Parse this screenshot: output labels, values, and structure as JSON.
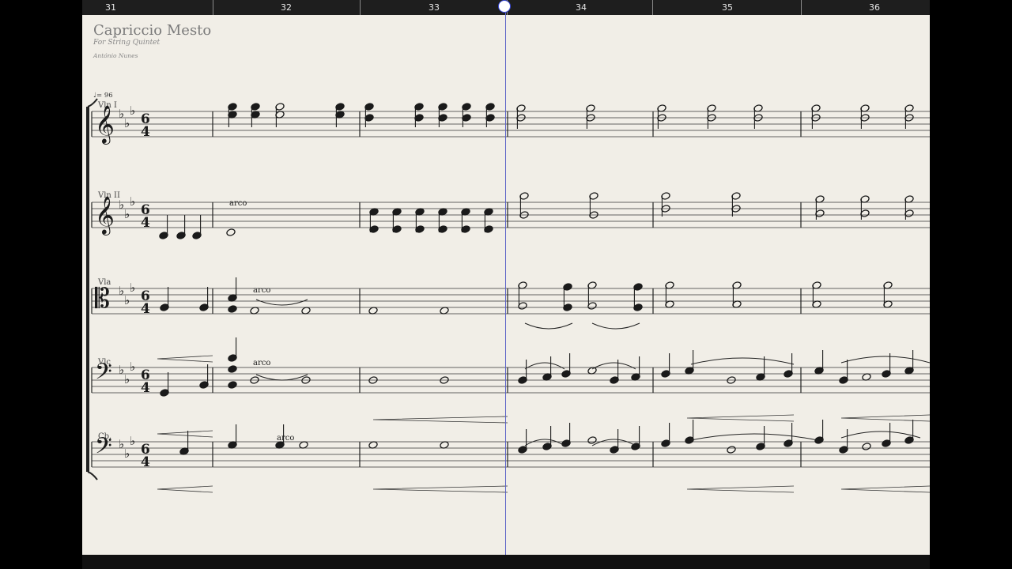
{
  "timeline": {
    "bars": [
      "31",
      "32",
      "33",
      "34",
      "35",
      "36"
    ]
  },
  "score": {
    "title": "Capriccio Mesto",
    "subtitle": "For String Quintet",
    "composer": "António Nunes",
    "tempo": "♩= 96",
    "time_signature": "6/4",
    "instruments": [
      "Vln I",
      "Vln II",
      "Vla",
      "Vlc",
      "Cb."
    ],
    "technique_text": "arco"
  },
  "colors": {
    "paper": "#f1eee7",
    "timeline": "#1e1e1e",
    "playhead": "#3b4bd8",
    "ink": "#1a1a1a"
  },
  "icons": {
    "playhead": "playhead-knob"
  }
}
